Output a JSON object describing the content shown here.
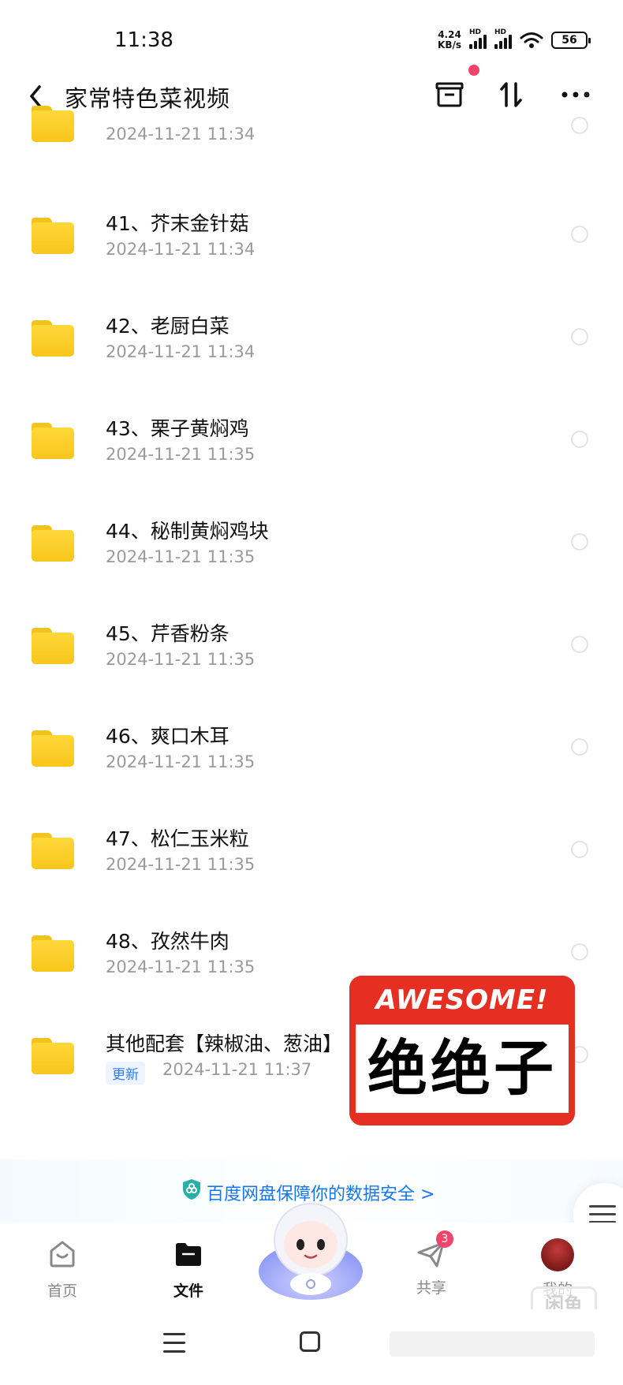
{
  "status_bar": {
    "time": "11:38",
    "net_speed_value": "4.24",
    "net_speed_unit": "KB/s",
    "signal1_label": "HD",
    "signal2_label": "HD",
    "battery": "56"
  },
  "nav": {
    "title": "家常特色菜视频",
    "icons": [
      "back-icon",
      "recycle-box-icon",
      "sort-icon",
      "more-icon"
    ]
  },
  "files": [
    {
      "name": "",
      "date": "2024-11-21  11:34"
    },
    {
      "name": "41、芥末金针菇",
      "date": "2024-11-21  11:34"
    },
    {
      "name": "42、老厨白菜",
      "date": "2024-11-21  11:34"
    },
    {
      "name": "43、栗子黄焖鸡",
      "date": "2024-11-21  11:35"
    },
    {
      "name": "44、秘制黄焖鸡块",
      "date": "2024-11-21  11:35"
    },
    {
      "name": "45、芹香粉条",
      "date": "2024-11-21  11:35"
    },
    {
      "name": "46、爽口木耳",
      "date": "2024-11-21  11:35"
    },
    {
      "name": "47、松仁玉米粒",
      "date": "2024-11-21  11:35"
    },
    {
      "name": "48、孜然牛肉",
      "date": "2024-11-21  11:35"
    },
    {
      "name": "其他配套【辣椒油、葱油】",
      "date": "2024-11-21  11:37",
      "badge": "更新"
    }
  ],
  "sticker": {
    "top_text": "AWESOME!",
    "main_text": "绝绝子"
  },
  "banner": {
    "text": "百度网盘保障你的数据安全 >"
  },
  "tabbar": {
    "tabs": [
      {
        "label": "首页",
        "icon": "home-icon"
      },
      {
        "label": "文件",
        "icon": "folder-icon",
        "active": true
      },
      {
        "label": "共享",
        "icon": "send-icon",
        "badge": "3"
      },
      {
        "label": "我的",
        "icon": "avatar"
      }
    ]
  },
  "watermark": "闲鱼",
  "colors": {
    "accent": "#1577ee",
    "badge": "#f1446a",
    "folder": "#ffd83a",
    "sticker_red": "#e52f22"
  }
}
